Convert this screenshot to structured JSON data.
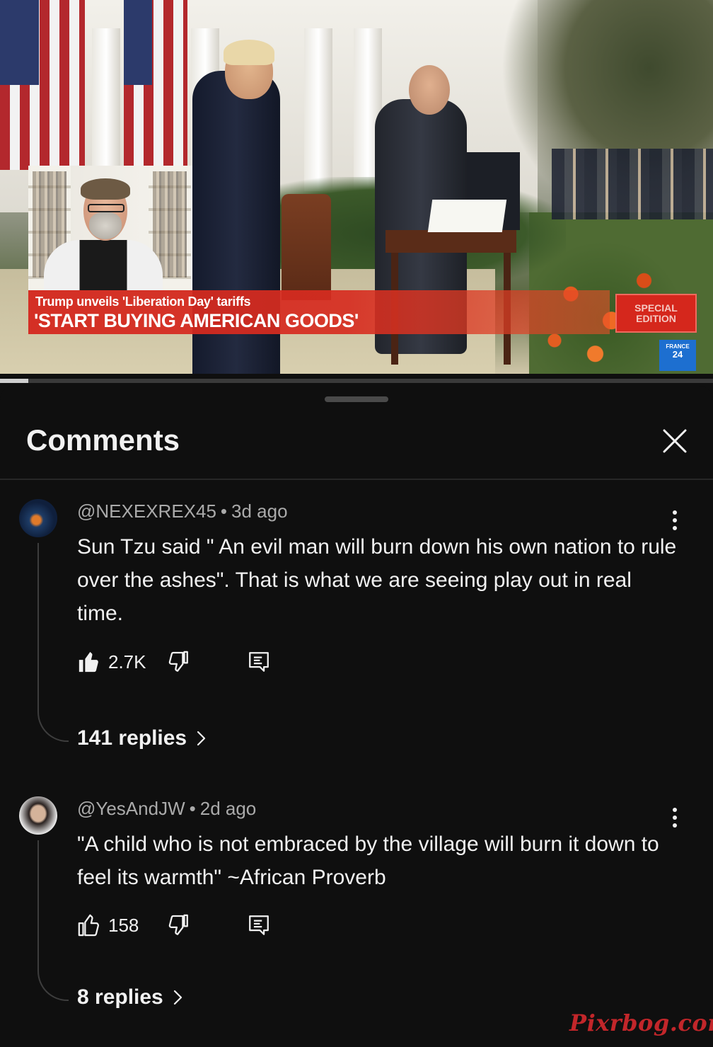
{
  "video": {
    "banner_line1": "Trump unveils 'Liberation Day' tariffs",
    "banner_line2": "'START BUYING AMERICAN GOODS'",
    "special_edition_line1": "SPECIAL",
    "special_edition_line2": "EDITION",
    "channel_logo_top": "FRANCE",
    "channel_logo_num": "24",
    "progress_fraction": 0.04
  },
  "comments_panel": {
    "title": "Comments",
    "close_icon": "close-icon",
    "comments": [
      {
        "author": "@NEXEXREX45",
        "time": "3d ago",
        "text": "Sun Tzu said \" An evil man will burn down his own nation to rule over the ashes\". That is what we are seeing play out in real time.",
        "likes": "2.7K",
        "liked": true,
        "replies": "141 replies"
      },
      {
        "author": "@YesAndJW",
        "time": "2d ago",
        "text": "\"A child who is not embraced by the village will burn it down to feel its warmth\"  ~African Proverb",
        "likes": "158",
        "liked": false,
        "replies": "8 replies"
      }
    ]
  },
  "watermark": "Pixrbog.com",
  "colors": {
    "background": "#0f0f0f",
    "text_primary": "#f1f1f1",
    "text_secondary": "#aaaaaa",
    "banner_red": "#d5271c"
  }
}
